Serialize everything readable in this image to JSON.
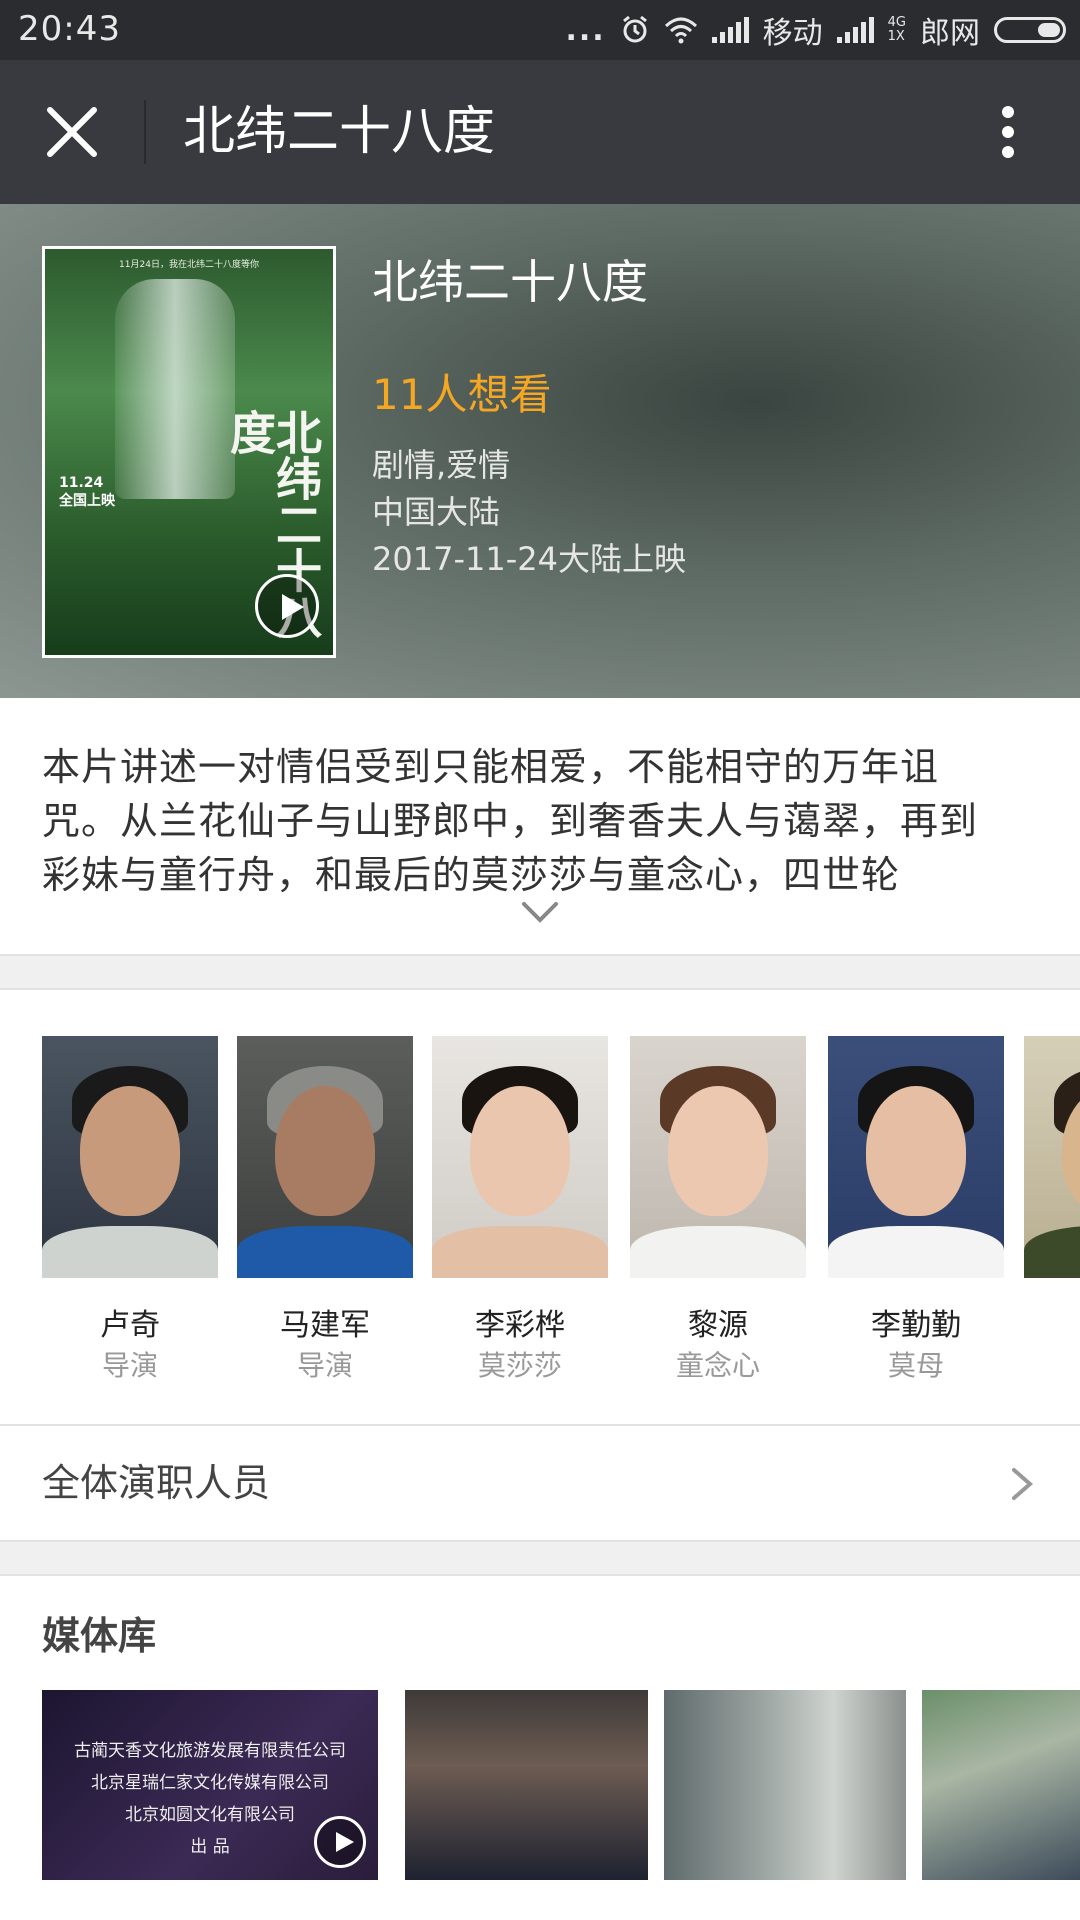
{
  "status_bar": {
    "time": "20:43",
    "dots": "...",
    "carrier1": "移动",
    "net_top": "4G",
    "net_bottom": "1X",
    "carrier2": "郎网",
    "icons": [
      "alarm-icon",
      "wifi-icon",
      "signal-icon",
      "battery-icon"
    ]
  },
  "titlebar": {
    "title": "北纬二十八度",
    "close_icon": "close-icon",
    "more_icon": "more-vertical-icon"
  },
  "movie": {
    "title": "北纬二十八度",
    "want_to_see": "11人想看",
    "genre": "剧情,爱情",
    "region": "中国大陆",
    "release": "2017-11-24大陆上映",
    "poster": {
      "top_text": "11月24日，我在北纬二十八度等你",
      "calligraphy": "北纬二十八度",
      "date_line1": "11.24",
      "date_line2": "全国上映"
    }
  },
  "synopsis": {
    "text": "本片讲述一对情侣受到只能相爱，不能相守的万年诅咒。从兰花仙子与山野郎中，到奢香夫人与蔼翠，再到彩妹与童行舟，和最后的莫莎莎与童念心，四世轮"
  },
  "cast": [
    {
      "name": "卢奇",
      "role": "导演"
    },
    {
      "name": "马建军",
      "role": "导演"
    },
    {
      "name": "李彩桦",
      "role": "莫莎莎"
    },
    {
      "name": "黎源",
      "role": "童念心"
    },
    {
      "name": "李勤勤",
      "role": "莫母"
    }
  ],
  "all_cast": {
    "label": "全体演职人员"
  },
  "media": {
    "title": "媒体库",
    "credits": [
      "古蔺天香文化旅游发展有限责任公司",
      "北京星瑞仁家文化传媒有限公司",
      "北京如圆文化有限公司",
      "出 品"
    ]
  }
}
